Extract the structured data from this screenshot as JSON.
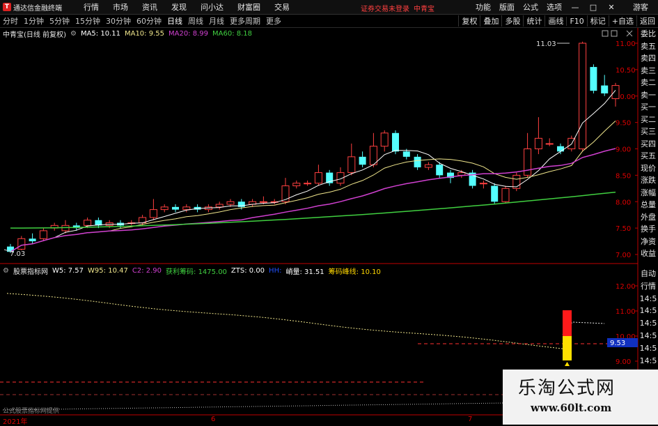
{
  "menubar": {
    "app_title": "通达信金融终端",
    "items": [
      "行情",
      "市场",
      "资讯",
      "发现",
      "问小达",
      "财富圈",
      "交易"
    ],
    "notice": "证券交易未登录",
    "stock_name": "中青宝",
    "right_items": [
      "功能",
      "版面",
      "公式",
      "选项"
    ],
    "window_buttons": [
      "—",
      "□",
      "✕"
    ],
    "guest": "游客"
  },
  "toolbar": {
    "periods": [
      "分时",
      "1分钟",
      "5分钟",
      "15分钟",
      "30分钟",
      "60分钟",
      "日线",
      "周线",
      "月线",
      "更多周期",
      "更多"
    ],
    "right": [
      "复权",
      "叠加",
      "多股",
      "统计",
      "画线",
      "F10",
      "标记",
      "+自选",
      "返回"
    ]
  },
  "kline": {
    "stock_label": "中青宝(日线 前复权)",
    "ma": [
      {
        "label": "MA5: 10.11",
        "color": "#ffffff"
      },
      {
        "label": "MA10: 9.55",
        "color": "#f0e68c"
      },
      {
        "label": "MA20: 8.99",
        "color": "#d040d0"
      },
      {
        "label": "MA60: 8.18",
        "color": "#40d040"
      }
    ],
    "y_ticks": [
      "11.00",
      "10.50",
      "10.00",
      "9.50",
      "9.00",
      "8.50",
      "8.00",
      "7.50",
      "7.00"
    ],
    "high_label": "11.03",
    "low_label": "7.03"
  },
  "indicator": {
    "name": "股票指标网",
    "items": [
      {
        "label": "W5: 7.57",
        "color": "#ffffff"
      },
      {
        "label": "W95: 10.47",
        "color": "#f0e68c"
      },
      {
        "label": "C2: 2.90",
        "color": "#d040d0"
      },
      {
        "label": "获利筹码: 1475.00",
        "color": "#40d040"
      },
      {
        "label": "ZTS: 0.00",
        "color": "#ffffff"
      },
      {
        "label": "HH:",
        "color": "#2050ff"
      },
      {
        "label": "峭量: 31.51",
        "color": "#ffffff"
      },
      {
        "label": "筹码峰线: 10.10",
        "color": "#ffd700"
      }
    ],
    "y_ticks": [
      "12.00",
      "11.00",
      "10.00",
      "9.00"
    ],
    "current_value": "9.53"
  },
  "side": {
    "upper": [
      "委比",
      "卖五",
      "卖四",
      "卖三",
      "卖二",
      "卖一",
      "买一",
      "买二",
      "买三",
      "买四",
      "买五",
      "现价",
      "涨跌",
      "涨幅",
      "总量",
      "外盘",
      "换手",
      "净资",
      "收益"
    ],
    "lower": [
      "自动",
      "行情",
      "14:5",
      "14:5",
      "14:5",
      "14:5",
      "14:5",
      "14:5",
      "14:5",
      "14:5"
    ]
  },
  "dates": [
    "2021年",
    "6",
    "7"
  ],
  "formula_caption": "公式股票指标网提供",
  "watermark": {
    "title": "乐淘公式网",
    "url": "www.60lt.com"
  },
  "colors": {
    "up": "#ff4040",
    "down": "#54ffff",
    "axis": "#c00000"
  }
}
